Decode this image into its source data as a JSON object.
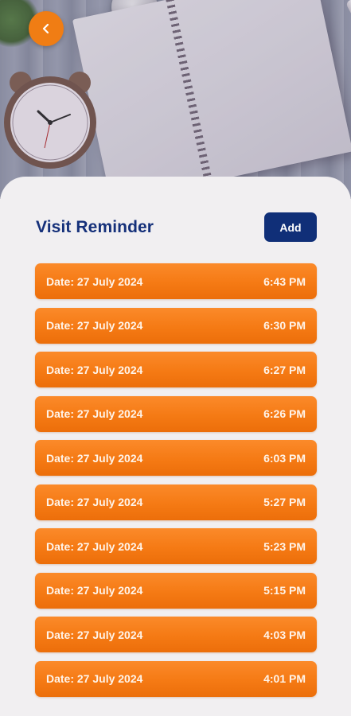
{
  "header": {
    "back_icon": "chevron-left-icon",
    "accent_color": "#f07d14"
  },
  "main": {
    "title": "Visit Reminder",
    "add_label": "Add",
    "title_color": "#15307a",
    "reminders": [
      {
        "date": "Date: 27 July 2024",
        "time": "6:43 PM"
      },
      {
        "date": "Date: 27 July 2024",
        "time": "6:30 PM"
      },
      {
        "date": "Date: 27 July 2024",
        "time": "6:27 PM"
      },
      {
        "date": "Date: 27 July 2024",
        "time": "6:26 PM"
      },
      {
        "date": "Date: 27 July 2024",
        "time": "6:03 PM"
      },
      {
        "date": "Date: 27 July 2024",
        "time": "5:27 PM"
      },
      {
        "date": "Date: 27 July 2024",
        "time": "5:23 PM"
      },
      {
        "date": "Date: 27 July 2024",
        "time": "5:15 PM"
      },
      {
        "date": "Date: 27 July 2024",
        "time": "4:03 PM"
      },
      {
        "date": "Date: 27 July 2024",
        "time": "4:01 PM"
      }
    ]
  }
}
